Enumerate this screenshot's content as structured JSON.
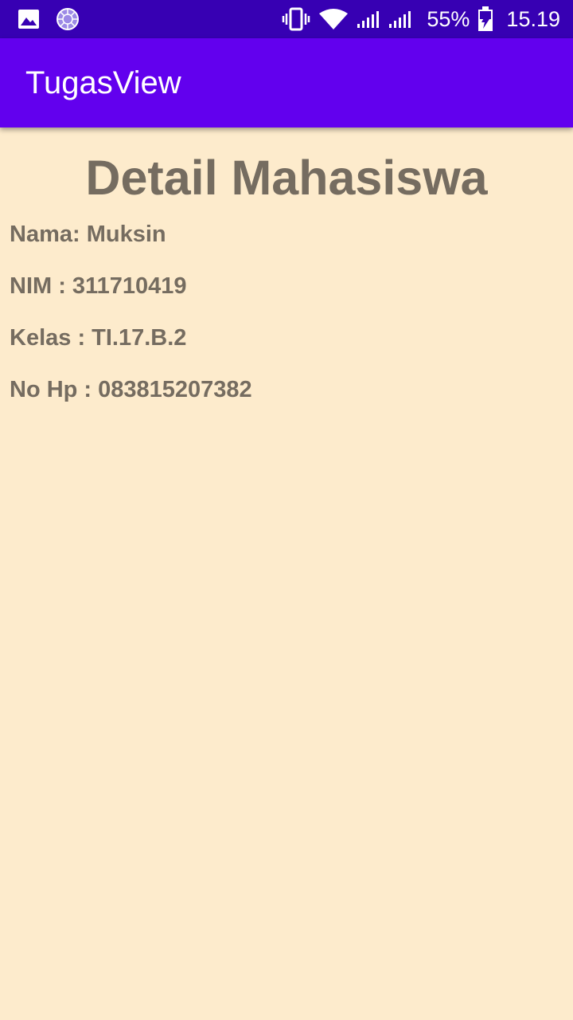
{
  "status_bar": {
    "battery_percent": "55%",
    "time": "15.19",
    "icons": [
      "image-icon",
      "sync-icon",
      "vibrate-icon",
      "wifi-icon",
      "signal-icon",
      "signal-icon",
      "battery-charging-icon"
    ]
  },
  "app_bar": {
    "title": "TugasView",
    "background": "#6200EE"
  },
  "main": {
    "title": "Detail Mahasiswa",
    "lines": [
      "Nama: Muksin",
      "NIM : 311710419",
      "Kelas : TI.17.B.2",
      "No Hp : 083815207382"
    ]
  },
  "colors": {
    "status_bar": "#3700B3",
    "app_bar": "#6200EE",
    "background": "#FDEBCC",
    "text": "#756C60"
  }
}
